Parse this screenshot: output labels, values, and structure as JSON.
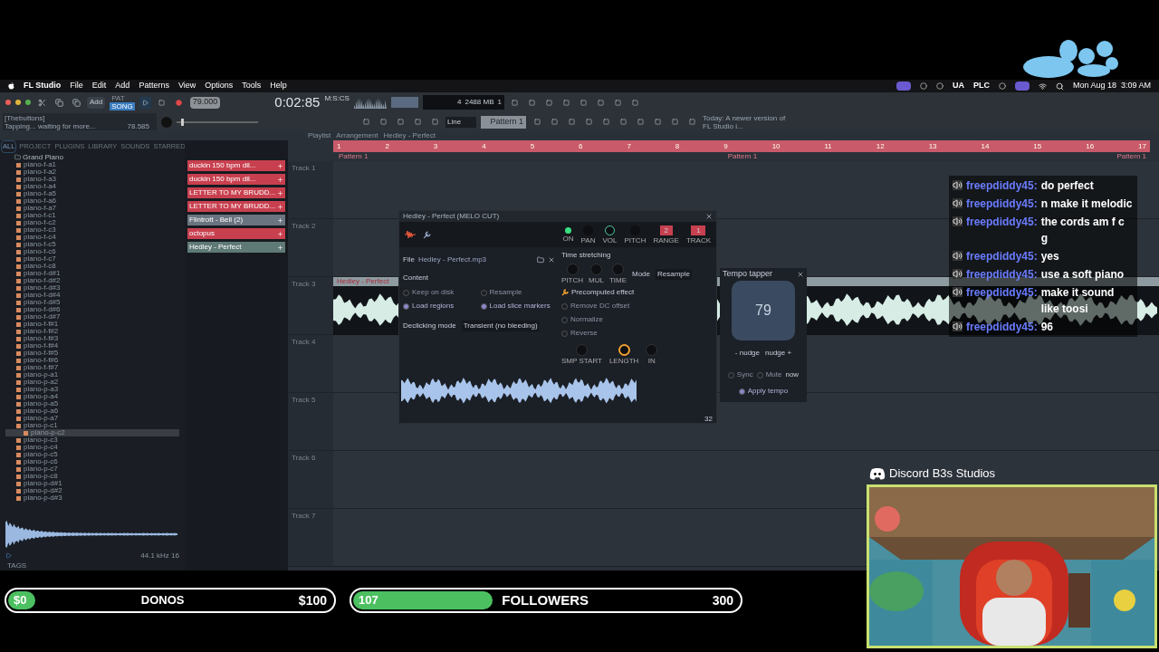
{
  "menu_bar": {
    "app": "FL Studio",
    "items": [
      "File",
      "Edit",
      "Add",
      "Patterns",
      "View",
      "Options",
      "Tools",
      "Help"
    ],
    "status_texts": [
      "UA",
      "PLC"
    ],
    "clock": "Mon Aug 18  3:09 AM"
  },
  "toolbar": {
    "add": "Add",
    "modes": [
      {
        "label": "PAT",
        "selected": false
      },
      {
        "label": "SONG",
        "selected": true
      }
    ],
    "tempo": "79.000",
    "time": "0:02:85",
    "time_unit": "M:S:CS",
    "memory": "2488 MB",
    "voices": "4",
    "cpu": "1",
    "hint_title": "[Thebuttons]",
    "hint": "Tapping... waiting for more...",
    "hint_value": "78.585",
    "master_pitch": {
      "level": 0.05
    },
    "snap": "Line",
    "pattern": "Pattern 1",
    "news": "Today: A newer version of FL Studio i..."
  },
  "breadcrumb": [
    "Playlist",
    "Arrangement",
    "Hedley - Perfect"
  ],
  "browser": {
    "tabs": [
      {
        "label": "ALL",
        "selected": true
      },
      {
        "label": "PROJECT",
        "selected": false
      },
      {
        "label": "PLUGINS",
        "selected": false
      },
      {
        "label": "LIBRARY",
        "selected": false
      },
      {
        "label": "SOUNDS",
        "selected": false
      },
      {
        "label": "STARRED",
        "selected": false
      }
    ],
    "folder": "Grand Piano",
    "files": [
      {
        "name": "piano-f-a1",
        "selected": false
      },
      {
        "name": "piano-f-a2",
        "selected": false
      },
      {
        "name": "piano-f-a3",
        "selected": false
      },
      {
        "name": "piano-f-a4",
        "selected": false
      },
      {
        "name": "piano-f-a5",
        "selected": false
      },
      {
        "name": "piano-f-a6",
        "selected": false
      },
      {
        "name": "piano-f-a7",
        "selected": false
      },
      {
        "name": "piano-f-c1",
        "selected": false
      },
      {
        "name": "piano-f-c2",
        "selected": false
      },
      {
        "name": "piano-f-c3",
        "selected": false
      },
      {
        "name": "piano-f-c4",
        "selected": false
      },
      {
        "name": "piano-f-c5",
        "selected": false
      },
      {
        "name": "piano-f-c6",
        "selected": false
      },
      {
        "name": "piano-f-c7",
        "selected": false
      },
      {
        "name": "piano-f-c8",
        "selected": false
      },
      {
        "name": "piano-f-d#1",
        "selected": false
      },
      {
        "name": "piano-f-d#2",
        "selected": false
      },
      {
        "name": "piano-f-d#3",
        "selected": false
      },
      {
        "name": "piano-f-d#4",
        "selected": false
      },
      {
        "name": "piano-f-d#5",
        "selected": false
      },
      {
        "name": "piano-f-d#6",
        "selected": false
      },
      {
        "name": "piano-f-d#7",
        "selected": false
      },
      {
        "name": "piano-f-f#1",
        "selected": false
      },
      {
        "name": "piano-f-f#2",
        "selected": false
      },
      {
        "name": "piano-f-f#3",
        "selected": false
      },
      {
        "name": "piano-f-f#4",
        "selected": false
      },
      {
        "name": "piano-f-f#5",
        "selected": false
      },
      {
        "name": "piano-f-f#6",
        "selected": false
      },
      {
        "name": "piano-f-f#7",
        "selected": false
      },
      {
        "name": "piano-p-a1",
        "selected": false
      },
      {
        "name": "piano-p-a2",
        "selected": false
      },
      {
        "name": "piano-p-a3",
        "selected": false
      },
      {
        "name": "piano-p-a4",
        "selected": false
      },
      {
        "name": "piano-p-a5",
        "selected": false
      },
      {
        "name": "piano-p-a6",
        "selected": false
      },
      {
        "name": "piano-p-a7",
        "selected": false
      },
      {
        "name": "piano-p-c1",
        "selected": false
      },
      {
        "name": "piano-p-c2",
        "selected": true
      },
      {
        "name": "piano-p-c3",
        "selected": false
      },
      {
        "name": "piano-p-c4",
        "selected": false
      },
      {
        "name": "piano-p-c5",
        "selected": false
      },
      {
        "name": "piano-p-c6",
        "selected": false
      },
      {
        "name": "piano-p-c7",
        "selected": false
      },
      {
        "name": "piano-p-c8",
        "selected": false
      },
      {
        "name": "piano-p-d#1",
        "selected": false
      },
      {
        "name": "piano-p-d#2",
        "selected": false
      },
      {
        "name": "piano-p-d#3",
        "selected": false
      }
    ],
    "sample_info": "44.1 kHz 16",
    "tags_label": "TAGS"
  },
  "channels": [
    {
      "name": "duckin 150 bpm dil...",
      "color": "#c8404f"
    },
    {
      "name": "duckin 150 bpm dil...",
      "color": "#c8404f"
    },
    {
      "name": "LETTER TO MY BRUDD...",
      "color": "#c8404f"
    },
    {
      "name": "LETTER TO MY BRUDD...",
      "color": "#c8404f"
    },
    {
      "name": "Flintrott - Bell (2)",
      "color": "#6a7480"
    },
    {
      "name": "octopus",
      "color": "#c8404f"
    },
    {
      "name": "Hedley - Perfect",
      "color": "#5f7a76"
    }
  ],
  "playlist": {
    "bars": [
      "1",
      "2",
      "3",
      "4",
      "5",
      "6",
      "7",
      "8",
      "9",
      "10",
      "11",
      "12",
      "13",
      "14",
      "15",
      "16",
      "17"
    ],
    "markers": [
      "Pattern 1",
      "Pattern 1",
      "Pattern 1"
    ],
    "tracks": [
      {
        "name": "Track 1"
      },
      {
        "name": "Track 2"
      },
      {
        "name": "Track 3",
        "clip": "Hedley - Perfect"
      },
      {
        "name": "Track 4"
      },
      {
        "name": "Track 5"
      },
      {
        "name": "Track 6"
      },
      {
        "name": "Track 7"
      }
    ]
  },
  "plugin": {
    "title": "Hedley - Perfect (MELO CUT)",
    "knobs": [
      "ON",
      "PAN",
      "VOL",
      "PITCH",
      "RANGE",
      "TRACK"
    ],
    "range": "2",
    "track": "1",
    "file_label": "File",
    "file": "Hedley - Perfect.mp3",
    "content_label": "Content",
    "content_options": [
      {
        "label": "Keep on disk",
        "checked": false
      },
      {
        "label": "Resample",
        "checked": false
      },
      {
        "label": "Load regions",
        "checked": true
      },
      {
        "label": "Load slice markers",
        "checked": true
      }
    ],
    "declick_label": "Declicking mode",
    "declick": "Transient (no bleeding)",
    "stretch_label": "Time stretching",
    "stretch_knobs": [
      "PITCH",
      "MUL",
      "TIME"
    ],
    "mode_label": "Mode",
    "mode": "Resample",
    "effects_label": "Precomputed effect",
    "effects": [
      {
        "label": "Remove DC offset",
        "checked": false
      },
      {
        "label": "Normalize",
        "checked": false
      },
      {
        "label": "Reverse",
        "checked": false
      }
    ],
    "sample_knobs": [
      "SMP START",
      "LENGTH",
      "IN"
    ],
    "zoom": "32"
  },
  "tempo_tapper": {
    "title": "Tempo tapper",
    "bpm": "79",
    "nudge_down": "- nudge",
    "nudge_up": "nudge +",
    "options": [
      {
        "label": "Sync",
        "checked": false
      },
      {
        "label": "Mute",
        "checked": false
      }
    ],
    "now": "now",
    "apply": {
      "label": "Apply tempo",
      "checked": true
    }
  },
  "chat": [
    {
      "user": "freepdiddy45:",
      "message": "do perfect"
    },
    {
      "user": "freepdiddy45:",
      "message": "n make it melodic"
    },
    {
      "user": "freepdiddy45:",
      "message": "the cords am f c g"
    },
    {
      "user": "freepdiddy45:",
      "message": "yes"
    },
    {
      "user": "freepdiddy45:",
      "message": "use a soft piano"
    },
    {
      "user": "freepdiddy45:",
      "message": "make it sound like toosi"
    },
    {
      "user": "freepdiddy45:",
      "message": "96"
    }
  ],
  "discord": "Discord B3s Studios",
  "goals": [
    {
      "label": "DONOS",
      "current": "$0",
      "target": "$100",
      "level": 0
    },
    {
      "label": "FOLLOWERS",
      "current": "107",
      "target": "300",
      "level": 0.357
    }
  ]
}
